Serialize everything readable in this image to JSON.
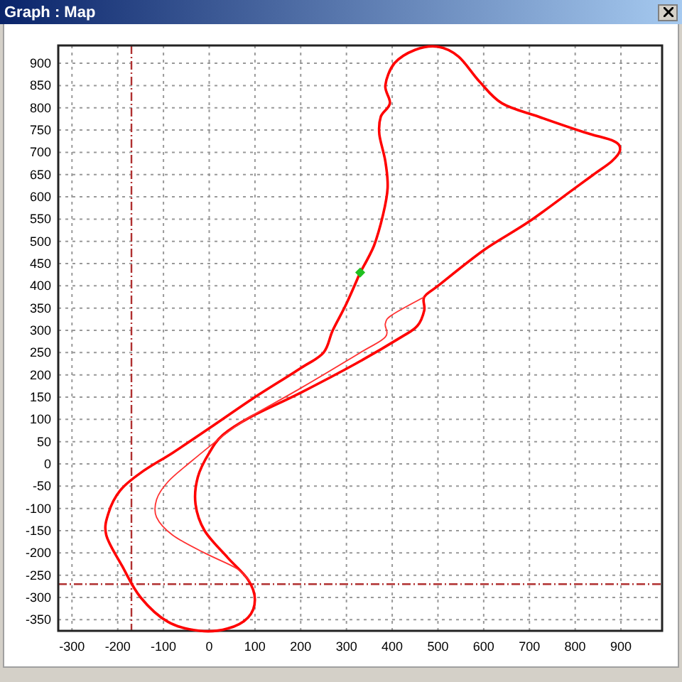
{
  "window": {
    "title": "Graph : Map"
  },
  "chart": {
    "chart_data": {
      "type": "line",
      "xlim": [
        -330,
        990
      ],
      "ylim": [
        -375,
        940
      ],
      "xticks": [
        -300,
        -200,
        -100,
        0,
        100,
        200,
        300,
        400,
        500,
        600,
        700,
        800,
        900
      ],
      "yticks": [
        -350,
        -300,
        -250,
        -200,
        -150,
        -100,
        -50,
        0,
        50,
        100,
        150,
        200,
        250,
        300,
        350,
        400,
        450,
        500,
        550,
        600,
        650,
        700,
        750,
        800,
        850,
        900
      ],
      "grid": true,
      "ref_lines": [
        {
          "axis": "x",
          "value": -170,
          "color": "#b03030"
        },
        {
          "axis": "y",
          "value": -270,
          "color": "#b03030"
        }
      ]
    }
  }
}
